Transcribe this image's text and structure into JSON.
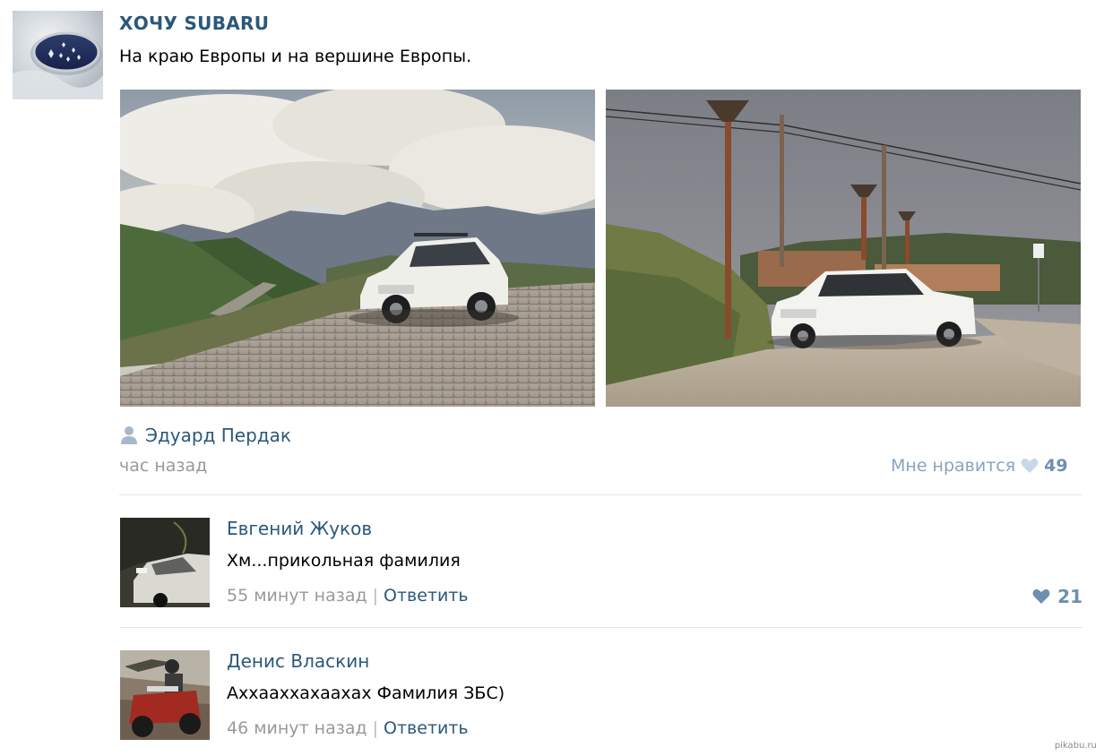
{
  "post": {
    "group_name": "ХОЧУ SUBARU",
    "text": "На краю Европы и на вершине Европы.",
    "author": "Эдуард Пердак",
    "time": "час назад",
    "like_label": "Мне нравится",
    "like_count": "49"
  },
  "comments": [
    {
      "name": "Евгений Жуков",
      "text": "Хм...прикольная фамилия",
      "time": "55 минут назад",
      "reply": "Ответить",
      "likes": "21"
    },
    {
      "name": "Денис Власкин",
      "text": "Аххааххахаахах Фамилия ЗБС)",
      "time": "46 минут назад",
      "reply": "Ответить"
    }
  ],
  "watermark": "pikabu.ru",
  "colors": {
    "link": "#2b587a",
    "muted": "#999999",
    "like": "#6e8fb0",
    "divider": "#e3e6ea"
  },
  "icons": {
    "author": "person-icon",
    "like": "heart-icon"
  }
}
